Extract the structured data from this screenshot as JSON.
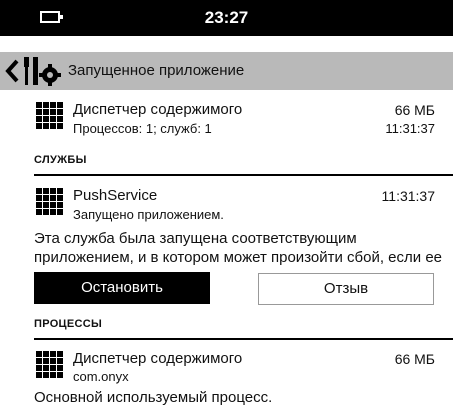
{
  "statusbar": {
    "time": "23:27"
  },
  "header": {
    "title": "Запущенное приложение"
  },
  "app": {
    "name": "Диспетчер содержимого",
    "size": "66 МБ",
    "details": "Процессов: 1; служб: 1",
    "time": "11:31:37"
  },
  "services": {
    "section_label": "СЛУЖБЫ",
    "item": {
      "name": "PushService",
      "subtitle": "Запущено приложением.",
      "time": "11:31:37"
    },
    "description": "Эта служба была запущена соответствующим приложением, и в котором может произойти сбой, если ее остановить.",
    "stop_label": "Остановить",
    "report_label": "Отзыв"
  },
  "processes": {
    "section_label": "ПРОЦЕССЫ",
    "item": {
      "name": "Диспетчер содержимого",
      "package": "com.onyx",
      "size": "66 МБ"
    },
    "description": "Основной используемый процесс."
  },
  "icons": {
    "back": "chevron-left-icon",
    "tools": "settings-tools-icon",
    "app": "grid-icon",
    "battery": "battery-icon"
  }
}
